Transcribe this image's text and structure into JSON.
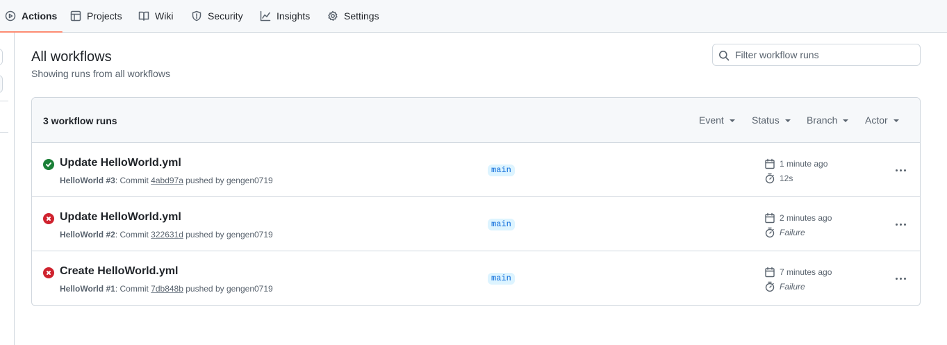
{
  "nav": {
    "tabs": [
      {
        "label": "Actions",
        "icon": "play-icon",
        "active": true
      },
      {
        "label": "Projects",
        "icon": "table-icon"
      },
      {
        "label": "Wiki",
        "icon": "book-icon"
      },
      {
        "label": "Security",
        "icon": "shield-icon"
      },
      {
        "label": "Insights",
        "icon": "graph-icon"
      },
      {
        "label": "Settings",
        "icon": "gear-icon"
      }
    ]
  },
  "header": {
    "title": "All workflows",
    "subtitle": "Showing runs from all workflows",
    "filter_placeholder": "Filter workflow runs"
  },
  "runs_box": {
    "count_label": "3 workflow runs",
    "filters": {
      "event": "Event",
      "status": "Status",
      "branch": "Branch",
      "actor": "Actor"
    },
    "runs": [
      {
        "status": "success",
        "title": "Update HelloWorld.yml",
        "workflow": "HelloWorld",
        "run_number": "#3",
        "commit_prefix": ": Commit",
        "sha": "4abd97a",
        "pushed_by": "pushed by gengen0719",
        "branch": "main",
        "when": "1 minute ago",
        "duration": "12s"
      },
      {
        "status": "failure",
        "title": "Update HelloWorld.yml",
        "workflow": "HelloWorld",
        "run_number": "#2",
        "commit_prefix": ": Commit",
        "sha": "322631d",
        "pushed_by": "pushed by gengen0719",
        "branch": "main",
        "when": "2 minutes ago",
        "duration": "Failure"
      },
      {
        "status": "failure",
        "title": "Create HelloWorld.yml",
        "workflow": "HelloWorld",
        "run_number": "#1",
        "commit_prefix": ": Commit",
        "sha": "7db848b",
        "pushed_by": "pushed by gengen0719",
        "branch": "main",
        "when": "7 minutes ago",
        "duration": "Failure"
      }
    ]
  },
  "colors": {
    "success": "#1a7f37",
    "failure": "#cf222e",
    "active_tab_underline": "#fd8c73",
    "branch_bg": "#ddf4ff",
    "branch_fg": "#0969da"
  }
}
